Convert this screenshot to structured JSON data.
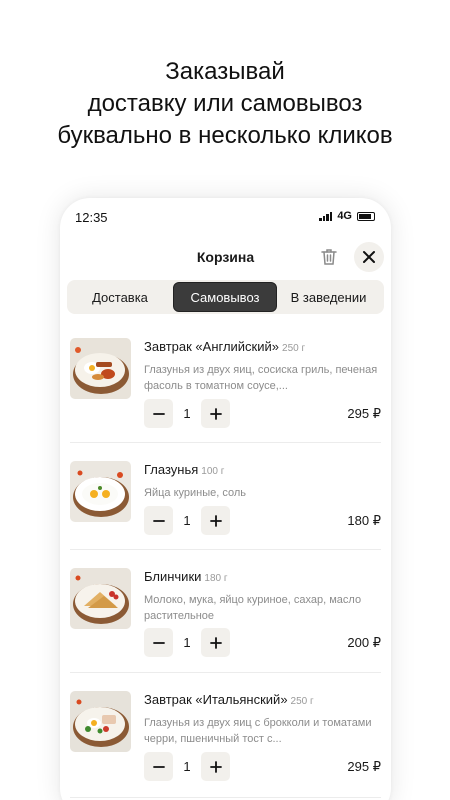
{
  "promo": {
    "line1": "Заказывай",
    "line2": "доставку или самовывоз",
    "line3": "буквально в несколько кликов"
  },
  "status_bar": {
    "time": "12:35",
    "network": "4G"
  },
  "header": {
    "title": "Корзина"
  },
  "tabs": [
    {
      "label": "Доставка",
      "active": false
    },
    {
      "label": "Самовывоз",
      "active": true
    },
    {
      "label": "В заведении",
      "active": false
    }
  ],
  "items": [
    {
      "name": "Завтрак «Английский»",
      "weight": "250 г",
      "description": "Глазунья из двух яиц, сосиска гриль, печеная фасоль в томатном соусе,...",
      "quantity": "1",
      "price": "295 ₽"
    },
    {
      "name": "Глазунья",
      "weight": "100 г",
      "description": "Яйца куриные, соль",
      "quantity": "1",
      "price": "180 ₽"
    },
    {
      "name": "Блинчики",
      "weight": "180 г",
      "description": "Молоко, мука, яйцо куриное, сахар, масло растительное",
      "quantity": "1",
      "price": "200 ₽"
    },
    {
      "name": "Завтрак «Итальянский»",
      "weight": "250 г",
      "description": "Глазунья из двух яиц с брокколи и томатами черри, пшеничный тост с...",
      "quantity": "1",
      "price": "295 ₽"
    }
  ]
}
